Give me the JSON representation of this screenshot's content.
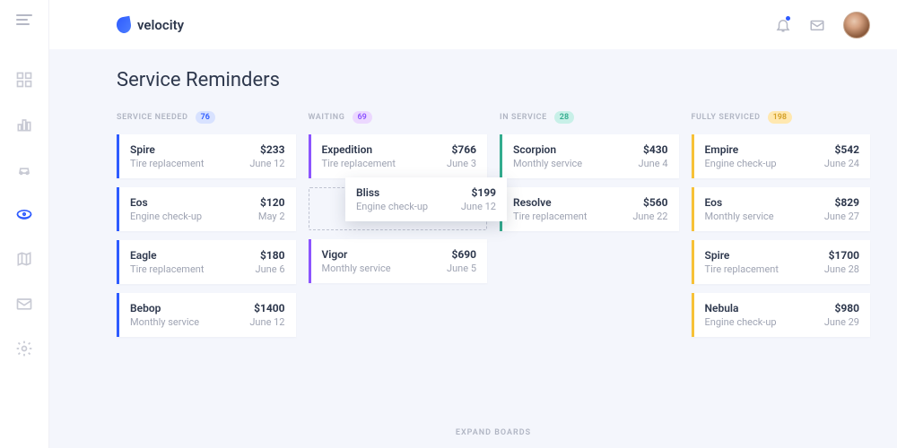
{
  "brand": {
    "name": "velocity"
  },
  "page": {
    "title": "Service Reminders"
  },
  "footer": {
    "expand": "EXPAND BOARDS"
  },
  "columns": [
    {
      "title": "SERVICE NEEDED",
      "count": "76",
      "color": "blue",
      "cards": [
        {
          "title": "Spire",
          "sub": "Tire replacement",
          "price": "$233",
          "date": "June 12"
        },
        {
          "title": "Eos",
          "sub": "Engine check-up",
          "price": "$120",
          "date": "May 2"
        },
        {
          "title": "Eagle",
          "sub": "Tire replacement",
          "price": "$180",
          "date": "June 6"
        },
        {
          "title": "Bebop",
          "sub": "Monthly service",
          "price": "$1400",
          "date": "June 12"
        }
      ]
    },
    {
      "title": "WAITING",
      "count": "69",
      "color": "purple",
      "cards": [
        {
          "title": "Expedition",
          "sub": "Tire replacement",
          "price": "$766",
          "date": "June 3"
        },
        {
          "placeholder": true
        },
        {
          "title": "Vigor",
          "sub": "Monthly service",
          "price": "$690",
          "date": "June 5"
        }
      ]
    },
    {
      "title": "IN SERVICE",
      "count": "28",
      "color": "teal",
      "cards": [
        {
          "title": "Scorpion",
          "sub": "Monthly service",
          "price": "$430",
          "date": "June 4"
        },
        {
          "title": "Resolve",
          "sub": "Tire replacement",
          "price": "$560",
          "date": "June 22"
        }
      ]
    },
    {
      "title": "FULLY SERVICED",
      "count": "198",
      "color": "yellow",
      "cards": [
        {
          "title": "Empire",
          "sub": "Engine check-up",
          "price": "$542",
          "date": "June 24"
        },
        {
          "title": "Eos",
          "sub": "Monthly service",
          "price": "$829",
          "date": "June 27"
        },
        {
          "title": "Spire",
          "sub": "Tire replacement",
          "price": "$1700",
          "date": "June 28"
        },
        {
          "title": "Nebula",
          "sub": "Engine check-up",
          "price": "$980",
          "date": "June 29"
        }
      ]
    }
  ],
  "dragging": {
    "title": "Bliss",
    "sub": "Engine check-up",
    "price": "$199",
    "date": "June 12"
  }
}
